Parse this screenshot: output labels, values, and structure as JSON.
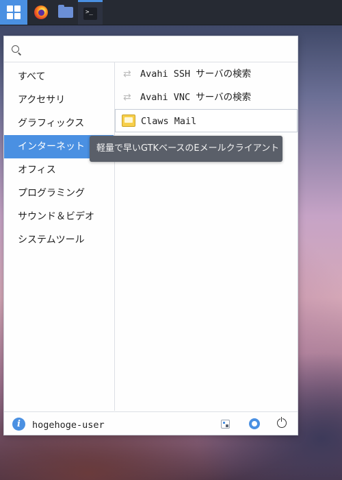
{
  "panel": {
    "apps_button_icon": "grid-icon",
    "firefox_icon": "firefox-icon",
    "file_manager_icon": "folder-icon",
    "terminal_icon": "terminal-icon",
    "terminal_glyph": ">_"
  },
  "search": {
    "placeholder": "",
    "value": ""
  },
  "categories": [
    {
      "label": "すべて"
    },
    {
      "label": "アクセサリ"
    },
    {
      "label": "グラフィックス"
    },
    {
      "label": "インターネット",
      "selected": true
    },
    {
      "label": "オフィス"
    },
    {
      "label": "プログラミング"
    },
    {
      "label": "サウンド＆ビデオ"
    },
    {
      "label": "システムツール"
    }
  ],
  "apps": [
    {
      "label": "Avahi SSH サーバの検索",
      "icon": "share-icon"
    },
    {
      "label": "Avahi VNC サーバの検索",
      "icon": "share-icon"
    },
    {
      "label": "Claws Mail",
      "icon": "mail-icon"
    }
  ],
  "tooltip": {
    "text": "軽量で早いGTKベースのEメールクライアント"
  },
  "footer": {
    "username": "hogehoge-user",
    "info_icon": "info-icon",
    "settings_icon": "settings-icon",
    "lock_icon": "lock-screen-icon",
    "power_icon": "power-icon"
  },
  "colors": {
    "accent": "#4a90e2",
    "panel": "#262a33",
    "tooltip": "#5a5f69"
  }
}
